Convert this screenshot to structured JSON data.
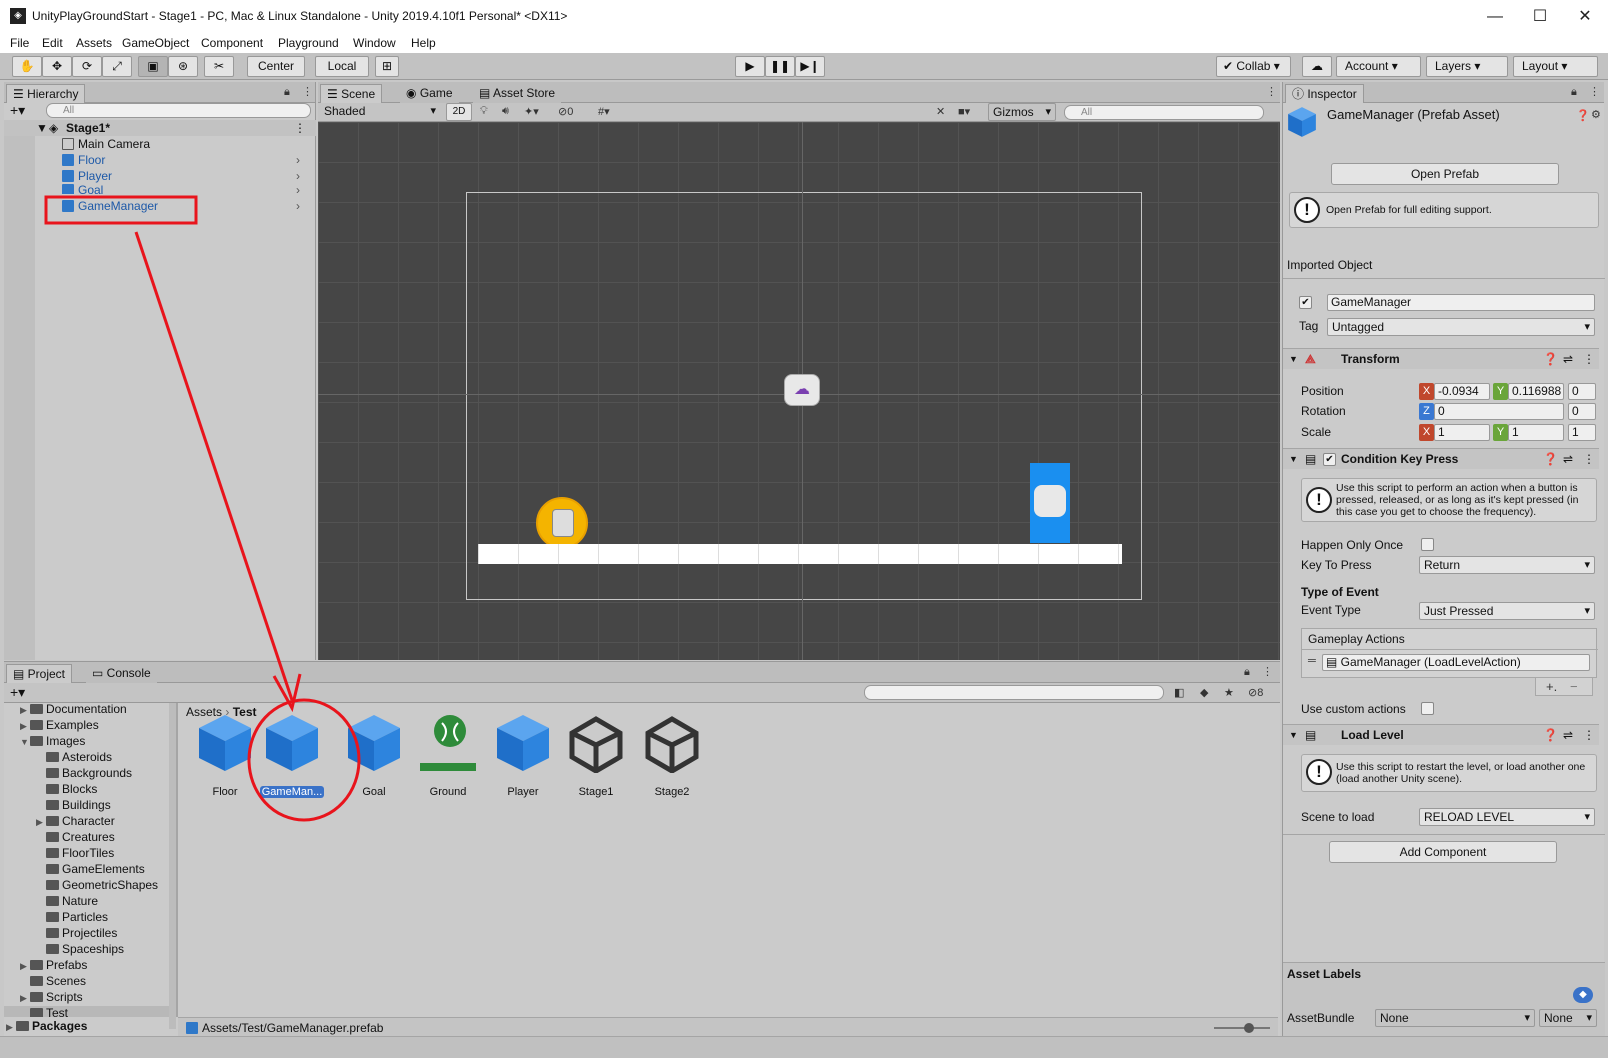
{
  "window": {
    "title": "UnityPlayGroundStart - Stage1 - PC, Mac & Linux Standalone - Unity 2019.4.10f1 Personal* <DX11>"
  },
  "menu": [
    "File",
    "Edit",
    "Assets",
    "GameObject",
    "Component",
    "Playground",
    "Window",
    "Help"
  ],
  "toolbar": {
    "center_label": "Center",
    "local_label": "Local",
    "collab_label": "Collab",
    "account_label": "Account",
    "layers_label": "Layers",
    "layout_label": "Layout"
  },
  "hierarchy": {
    "tab": "Hierarchy",
    "search_placeholder": "All",
    "scene": "Stage1*",
    "items": [
      {
        "label": "Main Camera"
      },
      {
        "label": "Floor"
      },
      {
        "label": "Player"
      },
      {
        "label": "Goal"
      },
      {
        "label": "GameManager"
      }
    ]
  },
  "scene_view": {
    "tabs": [
      "Scene",
      "Game",
      "Asset Store"
    ],
    "shading": "Shaded",
    "mode_2d": "2D",
    "hidden_count": "0",
    "gizmos": "Gizmos",
    "search_placeholder": "All"
  },
  "project": {
    "tabs": [
      "Project",
      "Console"
    ],
    "hidden_count": "8",
    "tree": [
      {
        "label": "Documentation",
        "indent": 1,
        "arrow": "▶"
      },
      {
        "label": "Examples",
        "indent": 1,
        "arrow": "▶"
      },
      {
        "label": "Images",
        "indent": 1,
        "arrow": "▼"
      },
      {
        "label": "Asteroids",
        "indent": 2,
        "arrow": ""
      },
      {
        "label": "Backgrounds",
        "indent": 2,
        "arrow": ""
      },
      {
        "label": "Blocks",
        "indent": 2,
        "arrow": ""
      },
      {
        "label": "Buildings",
        "indent": 2,
        "arrow": ""
      },
      {
        "label": "Character",
        "indent": 2,
        "arrow": "▶"
      },
      {
        "label": "Creatures",
        "indent": 2,
        "arrow": ""
      },
      {
        "label": "FloorTiles",
        "indent": 2,
        "arrow": ""
      },
      {
        "label": "GameElements",
        "indent": 2,
        "arrow": ""
      },
      {
        "label": "GeometricShapes",
        "indent": 2,
        "arrow": ""
      },
      {
        "label": "Nature",
        "indent": 2,
        "arrow": ""
      },
      {
        "label": "Particles",
        "indent": 2,
        "arrow": ""
      },
      {
        "label": "Projectiles",
        "indent": 2,
        "arrow": ""
      },
      {
        "label": "Spaceships",
        "indent": 2,
        "arrow": ""
      },
      {
        "label": "Prefabs",
        "indent": 1,
        "arrow": "▶"
      },
      {
        "label": "Scenes",
        "indent": 1,
        "arrow": ""
      },
      {
        "label": "Scripts",
        "indent": 1,
        "arrow": "▶"
      },
      {
        "label": "Test",
        "indent": 1,
        "arrow": ""
      },
      {
        "label": "Packages",
        "indent": 0,
        "arrow": "▶"
      }
    ],
    "breadcrumb": [
      "Assets",
      "Test"
    ],
    "assets": [
      {
        "label": "Floor",
        "kind": "prefab"
      },
      {
        "label": "GameMan...",
        "kind": "prefab"
      },
      {
        "label": "Goal",
        "kind": "prefab"
      },
      {
        "label": "Ground",
        "kind": "sprite"
      },
      {
        "label": "Player",
        "kind": "prefab"
      },
      {
        "label": "Stage1",
        "kind": "scene"
      },
      {
        "label": "Stage2",
        "kind": "scene"
      }
    ],
    "status_path": "Assets/Test/GameManager.prefab"
  },
  "inspector": {
    "tab": "Inspector",
    "title": "GameManager (Prefab Asset)",
    "open_prefab": "Open Prefab",
    "open_prefab_help": "Open Prefab for full editing support.",
    "imported_object": "Imported Object",
    "object_name": "GameManager",
    "tag_label": "Tag",
    "tag_value": "Untagged",
    "transform": {
      "title": "Transform",
      "position_label": "Position",
      "rotation_label": "Rotation",
      "scale_label": "Scale",
      "pos_x": "-0.0934",
      "pos_y": "0.116988",
      "pos_z": "0",
      "rot_z": "0",
      "rot_extra": "0",
      "scale_x": "1",
      "scale_y": "1",
      "scale_z": "1"
    },
    "condition": {
      "title": "Condition Key Press",
      "help": "Use this script to perform an action when a button is pressed, released, or as long as it's kept pressed (in this case you get to choose the frequency).",
      "happen_once": "Happen Only Once",
      "key_label": "Key To Press",
      "key_value": "Return",
      "type_header": "Type of Event",
      "event_label": "Event Type",
      "event_value": "Just Pressed",
      "actions_header": "Gameplay Actions",
      "action_item": "GameManager (LoadLevelAction)",
      "custom_actions": "Use custom actions"
    },
    "load_level": {
      "title": "Load Level",
      "help": "Use this script to restart the level, or load another one (load another Unity scene).",
      "scene_label": "Scene to load",
      "scene_value": "RELOAD LEVEL"
    },
    "add_component": "Add Component",
    "asset_labels": "Asset Labels",
    "assetbundle_label": "AssetBundle",
    "assetbundle_value": "None",
    "assetbundle_variant": "None"
  },
  "colors": {
    "annotation": "#e8141c",
    "accent": "#2f78c8",
    "scene_bg": "#464646"
  }
}
